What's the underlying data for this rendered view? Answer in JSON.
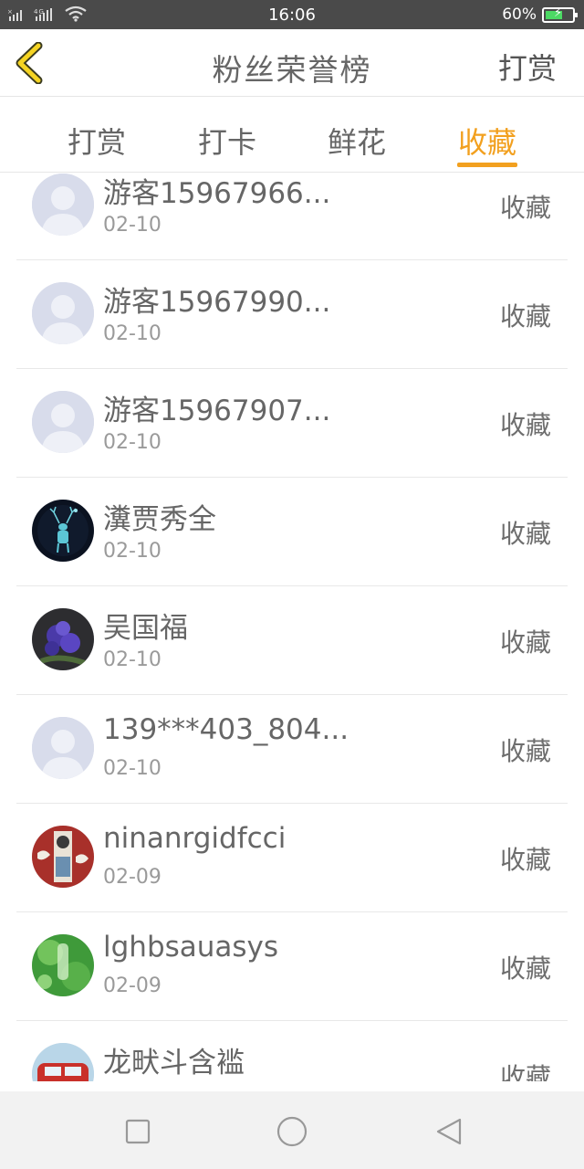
{
  "status_bar": {
    "time": "16:06",
    "battery_percent": "60%",
    "signal_text": "4G"
  },
  "header": {
    "title": "粉丝荣誉榜",
    "action_label": "打赏"
  },
  "tabs": [
    {
      "label": "打赏",
      "active": false
    },
    {
      "label": "打卡",
      "active": false
    },
    {
      "label": "鲜花",
      "active": false
    },
    {
      "label": "收藏",
      "active": true
    }
  ],
  "list": [
    {
      "name": "游客15967966...",
      "date": "02-10",
      "action": "收藏",
      "avatar": "default-avatar"
    },
    {
      "name": "游客15967990...",
      "date": "02-10",
      "action": "收藏",
      "avatar": "default-avatar"
    },
    {
      "name": "游客15967907...",
      "date": "02-10",
      "action": "收藏",
      "avatar": "default-avatar"
    },
    {
      "name": "瀵贾秀全",
      "date": "02-10",
      "action": "收藏",
      "avatar": "deer-avatar"
    },
    {
      "name": "吴国福",
      "date": "02-10",
      "action": "收藏",
      "avatar": "flower-avatar"
    },
    {
      "name": "139***403_804...",
      "date": "02-10",
      "action": "收藏",
      "avatar": "default-avatar"
    },
    {
      "name": "ninanrgidfcci",
      "date": "02-09",
      "action": "收藏",
      "avatar": "photo-avatar"
    },
    {
      "name": "lghbsauasys",
      "date": "02-09",
      "action": "收藏",
      "avatar": "green-avatar"
    },
    {
      "name": "龙畎斗含褴",
      "date": "",
      "action": "收藏",
      "avatar": "car-avatar"
    }
  ],
  "colors": {
    "accent": "#f2a01f",
    "status_bar_bg": "#4a4a4a",
    "battery_fill": "#4cd964"
  },
  "navbar": {
    "icons": [
      "square-icon",
      "circle-icon",
      "triangle-back-icon"
    ]
  }
}
